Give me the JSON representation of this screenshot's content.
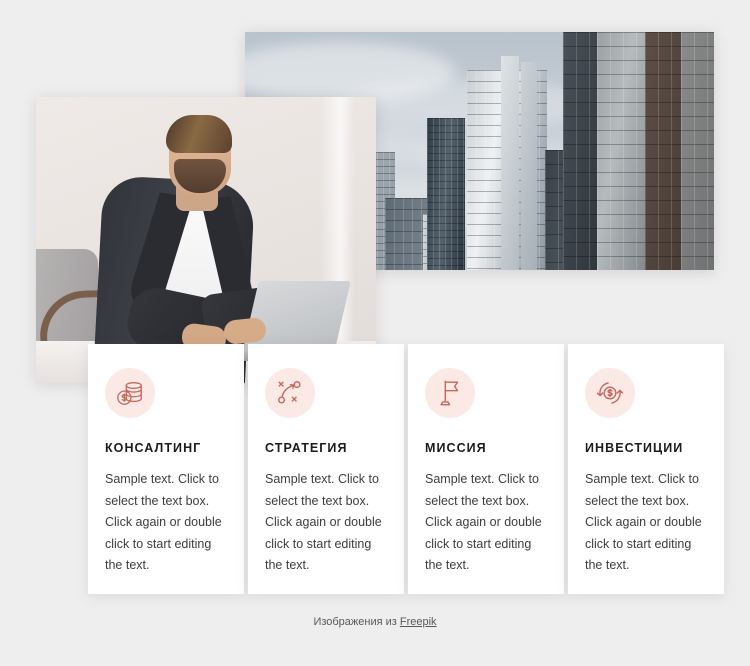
{
  "page": {
    "background_color": "#efeeee",
    "accent_color": "#c4695c",
    "icon_bg_color": "#fbe9e6"
  },
  "images": {
    "city": {
      "alt": "Modern glass office skyscrapers under a cloudy gray sky",
      "name": "city-skyline-photo"
    },
    "man": {
      "alt": "Bearded businessman in a dark blazer and white t-shirt working on a laptop",
      "name": "businessman-laptop-photo"
    }
  },
  "cards": [
    {
      "icon": "coins-dollar-icon",
      "title": "КОНСАЛТИНГ",
      "text": "Sample text. Click to select the text box. Click again or double click to start editing the text."
    },
    {
      "icon": "strategy-playbook-icon",
      "title": "СТРАТЕГИЯ",
      "text": "Sample text. Click to select the text box. Click again or double click to start editing the text."
    },
    {
      "icon": "flag-icon",
      "title": "МИССИЯ",
      "text": "Sample text. Click to select the text box. Click again or double click to start editing the text."
    },
    {
      "icon": "dollar-refresh-icon",
      "title": "ИНВЕСТИЦИИ",
      "text": "Sample text. Click to select the text box. Click again or double click to start editing the text."
    }
  ],
  "credit": {
    "prefix": "Изображения из ",
    "link_label": "Freepik"
  }
}
